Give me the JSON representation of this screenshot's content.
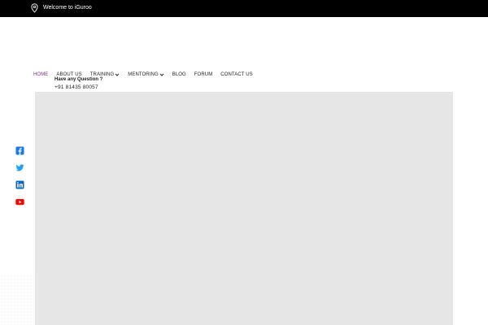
{
  "topbar": {
    "welcome_text": "Welcome to iGuroo",
    "bg_color": "#000000",
    "icon": "location-pin-icon"
  },
  "nav": {
    "items": [
      {
        "label": "HOME",
        "active": true
      },
      {
        "label": "ABOUT US"
      },
      {
        "label": "TRAINING",
        "dropdown": true
      },
      {
        "label": "MENTORING",
        "dropdown": true
      },
      {
        "label": "BLOG"
      },
      {
        "label": "FORUM"
      },
      {
        "label": "CONTACT US"
      }
    ],
    "active_color": "#7b2a8f"
  },
  "contact": {
    "question": "Have any Question ?",
    "phone": "+91 81435 80057"
  },
  "social": [
    {
      "icon": "facebook-icon",
      "color": "#1877f2"
    },
    {
      "icon": "twitter-icon",
      "color": "#1da1f2"
    },
    {
      "icon": "linkedin-icon",
      "color": "#0a66c2"
    },
    {
      "icon": "youtube-icon",
      "color": "#ff0000"
    }
  ],
  "hero": {
    "bg_color": "#e6e6e6"
  }
}
